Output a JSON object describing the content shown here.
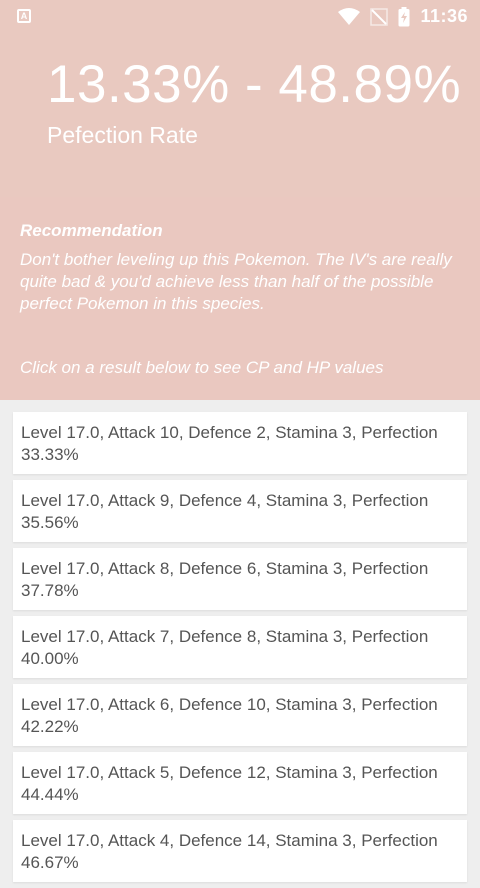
{
  "status": {
    "notification_icon": "a-box-icon",
    "time": "11:36"
  },
  "header": {
    "range": "13.33% - 48.89%",
    "label": "Pefection Rate"
  },
  "recommendation": {
    "title": "Recommendation",
    "text": "Don't bother leveling up this Pokemon. The IV's are really quite bad & you'd achieve less than half of the possible perfect Pokemon in this species.",
    "hint": "Click on a result below to see CP and HP values"
  },
  "results": [
    {
      "text": "Level 17.0, Attack 10, Defence 2, Stamina 3, Perfection 33.33%"
    },
    {
      "text": "Level 17.0, Attack 9, Defence 4, Stamina 3, Perfection 35.56%"
    },
    {
      "text": "Level 17.0, Attack 8, Defence 6, Stamina 3, Perfection 37.78%"
    },
    {
      "text": "Level 17.0, Attack 7, Defence 8, Stamina 3, Perfection 40.00%"
    },
    {
      "text": "Level 17.0, Attack 6, Defence 10, Stamina 3, Perfection 42.22%"
    },
    {
      "text": "Level 17.0, Attack 5, Defence 12, Stamina 3, Perfection 44.44%"
    },
    {
      "text": "Level 17.0, Attack 4, Defence 14, Stamina 3, Perfection 46.67%"
    }
  ],
  "colors": {
    "header_bg": "#e9c9c0",
    "recommendation_bg": "#eac8c0",
    "list_bg": "#eeeeee",
    "card_text": "#555555"
  }
}
